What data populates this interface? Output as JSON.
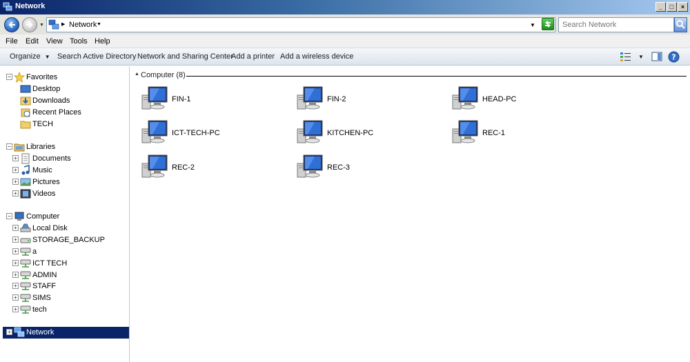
{
  "window": {
    "title": "Network"
  },
  "address": {
    "crumb": "Network",
    "search_placeholder": "Search Network"
  },
  "menu": [
    "File",
    "Edit",
    "View",
    "Tools",
    "Help"
  ],
  "commands": {
    "organize": "Organize",
    "search_ad": "Search Active Directory",
    "network_sharing": "Network and Sharing Center",
    "add_printer": "Add a printer",
    "add_wireless": "Add a wireless device"
  },
  "nav": {
    "favorites": {
      "label": "Favorites",
      "items": [
        "Desktop",
        "Downloads",
        "Recent Places",
        "TECH"
      ]
    },
    "libraries": {
      "label": "Libraries",
      "items": [
        "Documents",
        "Music",
        "Pictures",
        "Videos"
      ]
    },
    "computer": {
      "label": "Computer",
      "items": [
        "Local Disk",
        "STORAGE_BACKUP",
        "a",
        "ICT TECH",
        "ADMIN",
        "STAFF",
        "SIMS",
        "tech"
      ]
    },
    "network": {
      "label": "Network"
    }
  },
  "content": {
    "group_label": "Computer (8)",
    "computers": [
      "FIN-1",
      "FIN-2",
      "HEAD-PC",
      "ICT-TECH-PC",
      "KITCHEN-PC",
      "REC-1",
      "REC-2",
      "REC-3"
    ]
  },
  "colors": {
    "selection": "#0a246a",
    "title_gradient_start": "#0a246a",
    "title_gradient_end": "#a6caf0"
  }
}
